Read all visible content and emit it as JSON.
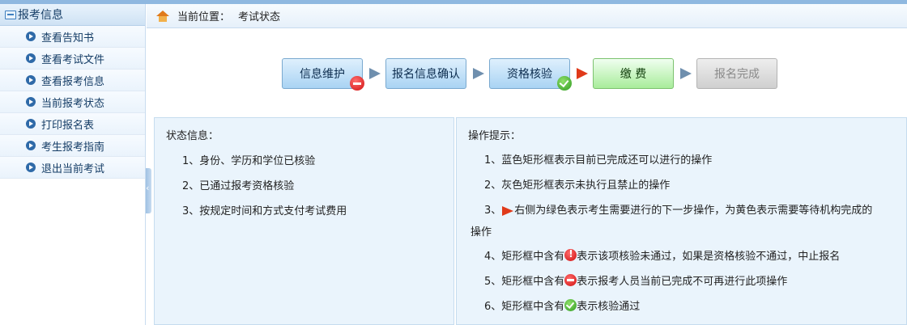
{
  "sidebar": {
    "title": "报考信息",
    "items": [
      {
        "label": "查看告知书"
      },
      {
        "label": "查看考试文件"
      },
      {
        "label": "查看报考信息"
      },
      {
        "label": "当前报考状态"
      },
      {
        "label": "打印报名表"
      },
      {
        "label": "考生报考指南"
      },
      {
        "label": "退出当前考试"
      }
    ]
  },
  "breadcrumb": {
    "label": "当前位置：",
    "value": "考试状态"
  },
  "steps": [
    {
      "label": "信息维护",
      "style": "blue",
      "badge": "minus-icon"
    },
    {
      "label": "报名信息确认",
      "style": "blue",
      "badge": ""
    },
    {
      "label": "资格核验",
      "style": "blue",
      "badge": "check-icon"
    },
    {
      "label": "缴 费",
      "style": "green",
      "badge": ""
    },
    {
      "label": "报名完成",
      "style": "gray",
      "badge": ""
    }
  ],
  "status_panel": {
    "title": "状态信息：",
    "lines": [
      "1、身份、学历和学位已核验",
      "2、已通过报考资格核验",
      "3、按规定时间和方式支付考试费用"
    ]
  },
  "tips_panel": {
    "title": "操作提示：",
    "line1": "1、蓝色矩形框表示目前已完成还可以进行的操作",
    "line2": "2、灰色矩形框表示未执行且禁止的操作",
    "line3_prefix": "3、",
    "line3_text": "右侧为绿色表示考生需要进行的下一步操作，为黄色表示需要等待机构完成的",
    "line3_cont": "操作",
    "line4_prefix": "4、矩形框中含有",
    "line4_suffix": "表示该项核验未通过，如果是资格核验不通过，中止报名",
    "line5_prefix": "5、矩形框中含有",
    "line5_suffix": "表示报考人员当前已完成不可再进行此项操作",
    "line6_prefix": "6、矩形框中含有",
    "line6_suffix": "表示核验通过"
  },
  "colors": {
    "step_blue": "#a9d3f3",
    "step_green": "#a8ec9a",
    "step_gray": "#cfcfcf",
    "arrow_red": "#e03a1a",
    "panel_bg": "#eaf4fc"
  }
}
